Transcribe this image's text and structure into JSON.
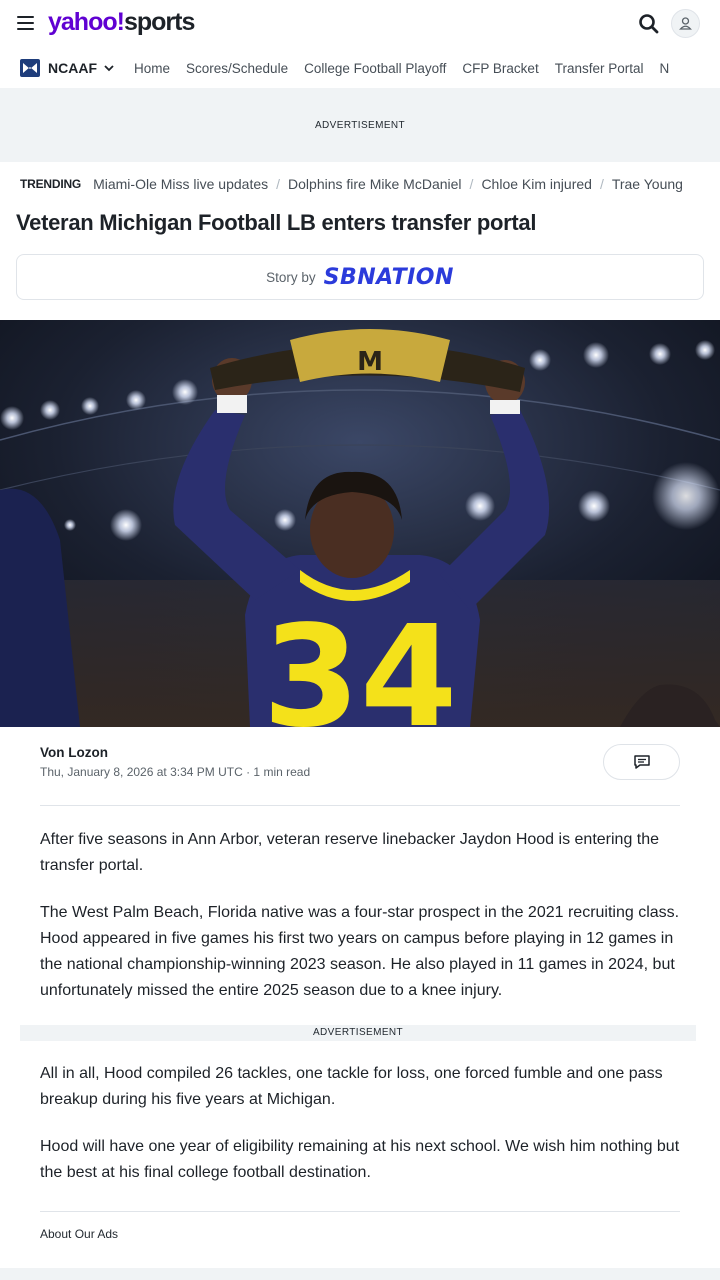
{
  "header": {
    "logo_yahoo": "yahoo!",
    "logo_section": "sports"
  },
  "nav": {
    "league": "NCAAF",
    "links": [
      "Home",
      "Scores/Schedule",
      "College Football Playoff",
      "CFP Bracket",
      "Transfer Portal",
      "N"
    ]
  },
  "ads": {
    "top_label": "ADVERTISEMENT",
    "mid_label": "ADVERTISEMENT",
    "about": "About Our Ads"
  },
  "trending": {
    "heading": "TRENDING",
    "items": [
      "Miami-Ole Miss live updates",
      "Dolphins fire Mike McDaniel",
      "Chloe Kim injured",
      "Trae Young"
    ]
  },
  "article": {
    "headline": "Veteran Michigan Football LB enters transfer portal",
    "story_by": "Story by",
    "source": "SBNATION",
    "hero": {
      "jersey_number": "34",
      "belt_letter": "M"
    },
    "author": "Von Lozon",
    "dateline": "Thu, January 8, 2026 at 3:34 PM UTC · 1 min read",
    "paragraphs": [
      "After five seasons in Ann Arbor, veteran reserve linebacker Jaydon Hood is entering the transfer portal.",
      "The West Palm Beach, Florida native was a four-star prospect in the 2021 recruiting class. Hood appeared in five games his first two years on campus before playing in 12 games in the national championship-winning 2023 season. He also played in 11 games in 2024, but unfortunately missed the entire 2025 season due to a knee injury.",
      "All in all, Hood compiled 26 tackles, one tackle for loss, one forced fumble and one pass breakup during his five years at Michigan.",
      "Hood will have one year of eligibility remaining at his next school. We wish him nothing but the best at his final college football destination."
    ]
  },
  "colors": {
    "brand_purple": "#6001d2",
    "sbnation_blue": "#2b3bdb",
    "jersey_navy": "#2a2f6e",
    "jersey_maize": "#f4e11a"
  }
}
